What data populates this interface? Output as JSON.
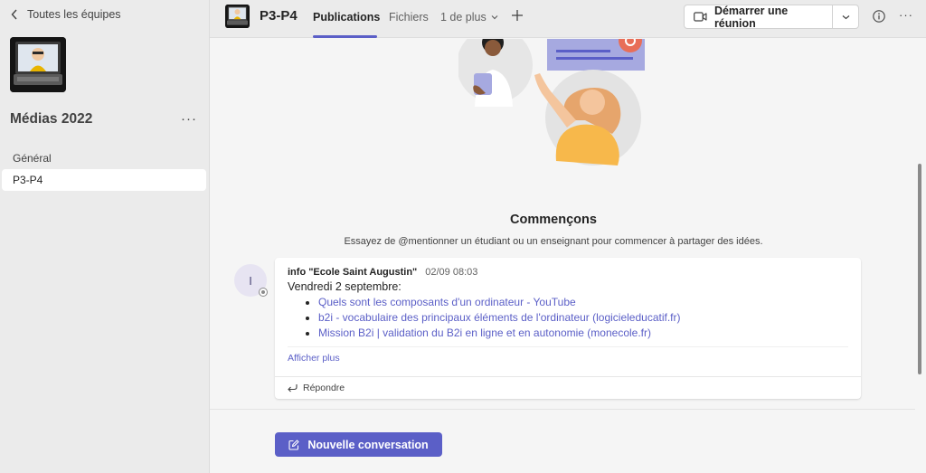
{
  "sidebar": {
    "back_label": "Toutes les équipes",
    "team_name": "Médias 2022",
    "more_label": "···",
    "channels": [
      {
        "label": "Général"
      },
      {
        "label": "P3-P4"
      }
    ]
  },
  "header": {
    "title": "P3-P4",
    "tabs": [
      {
        "label": "Publications"
      },
      {
        "label": "Fichiers"
      },
      {
        "label": "1 de plus"
      }
    ],
    "meet_label": "Démarrer une réunion",
    "more_label": "···"
  },
  "empty_state": {
    "title": "Commençons",
    "subtitle": "Essayez de @mentionner un étudiant ou un enseignant pour commencer à partager des idées."
  },
  "post": {
    "avatar_initial": "I",
    "author": "info \"Ecole Saint Augustin\"",
    "time": "02/09 08:03",
    "body": "Vendredi 2 septembre:",
    "links": [
      "Quels sont les composants d'un ordinateur - YouTube",
      "b2i - vocabulaire des principaux éléments de l'ordinateur (logicieleducatif.fr)",
      "Mission B2i | validation du B2i en ligne et en autonomie (monecole.fr)"
    ],
    "see_more": "Afficher plus",
    "reply": "Répondre"
  },
  "new_conversation_label": "Nouvelle conversation",
  "colors": {
    "accent": "#5b5fc7",
    "sidebar_bg": "#ebebeb",
    "main_bg": "#f5f5f5"
  },
  "icons": {
    "back": "chevron-left-icon",
    "tab_more": "chevron-down-icon",
    "add_tab": "plus-icon",
    "meet": "video-camera-icon",
    "meet_drop": "chevron-down-icon",
    "info": "info-icon",
    "reply": "reply-arrow-icon",
    "compose": "compose-icon"
  }
}
